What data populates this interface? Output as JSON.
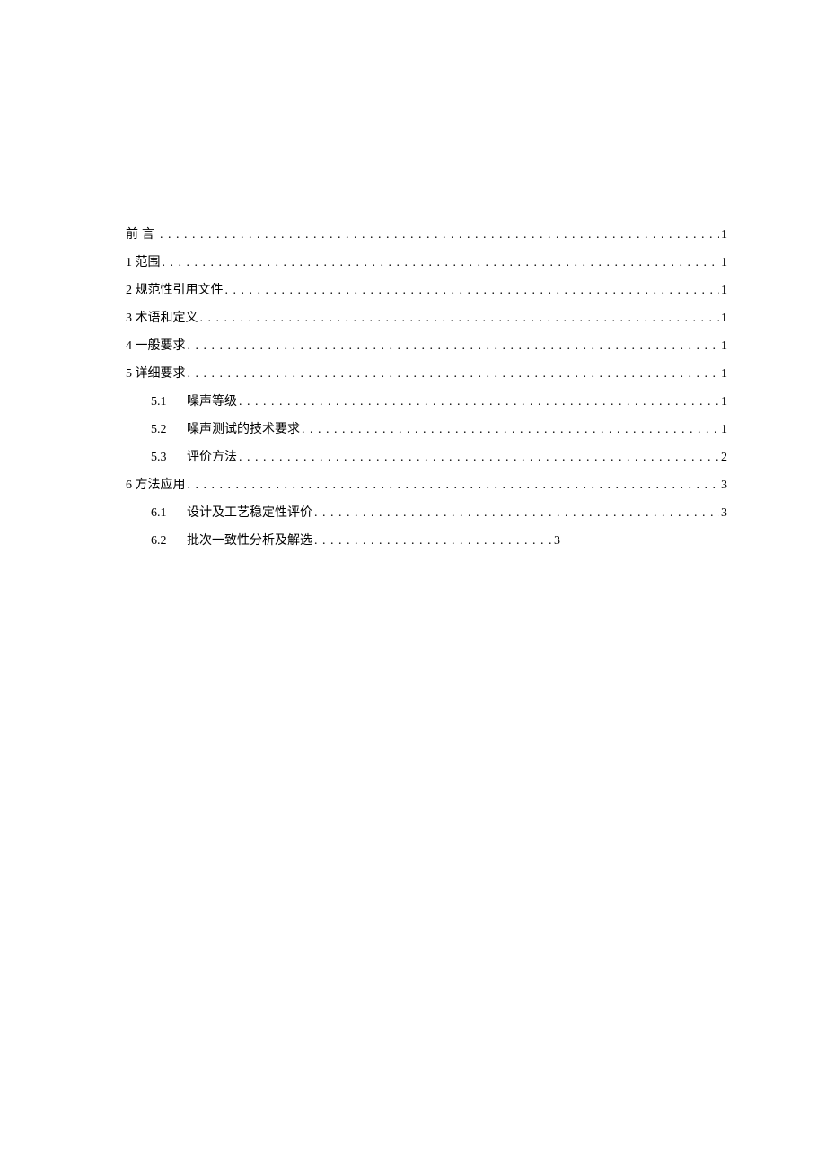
{
  "toc": {
    "entries": [
      {
        "label": "前言",
        "page": "1",
        "level": 0,
        "preface": true
      },
      {
        "label": "1 范围",
        "page": "1",
        "level": 0
      },
      {
        "label": "2 规范性引用文件",
        "page": "1",
        "level": 0
      },
      {
        "label": "3 术语和定义",
        "page": "1",
        "level": 0
      },
      {
        "label": "4 一般要求",
        "page": "1",
        "level": 0
      },
      {
        "label": "5 详细要求",
        "page": "1",
        "level": 0
      },
      {
        "num": "5.1",
        "label": "噪声等级",
        "page": "1",
        "level": 1
      },
      {
        "num": "5.2",
        "label": "噪声测试的技术要求",
        "page": "1",
        "level": 1
      },
      {
        "num": "5.3",
        "label": "评价方法",
        "page": "2",
        "level": 1
      },
      {
        "label": "6 方法应用",
        "page": "3",
        "level": 0
      },
      {
        "num": "6.1",
        "label": "设计及工艺稳定性评价",
        "page": "3",
        "level": 1
      },
      {
        "num": "6.2",
        "label": "批次一致性分析及解选",
        "page": "3",
        "level": 1,
        "short": true
      }
    ]
  }
}
